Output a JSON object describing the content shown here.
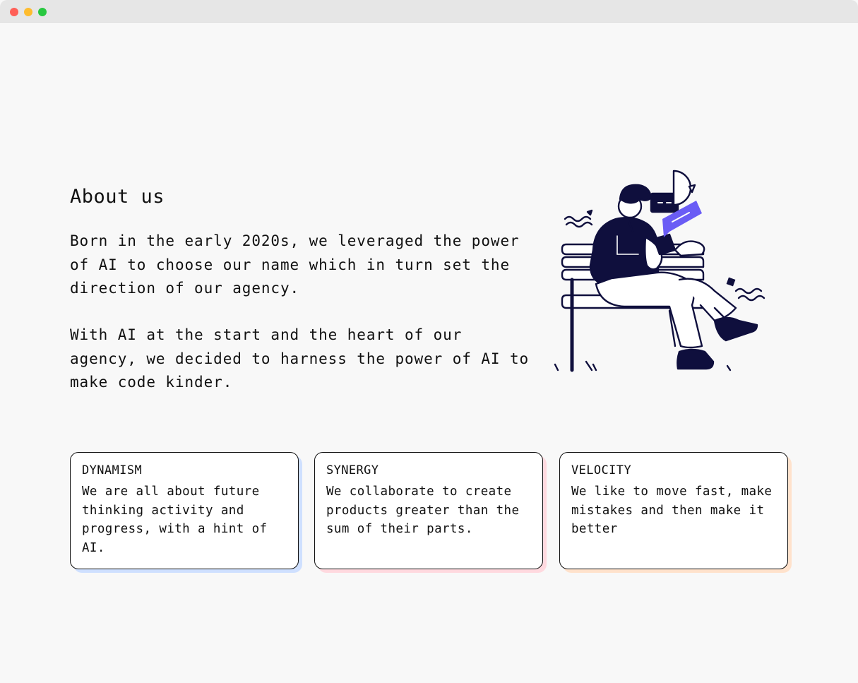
{
  "window": {
    "controls": [
      "close",
      "minimize",
      "maximize"
    ]
  },
  "about": {
    "heading": "About us",
    "paragraph_1": "Born in the early 2020s, we leveraged the power of AI to choose our name which in turn set the direction of our agency.",
    "paragraph_2": "With AI at the start and the heart of our agency, we decided to harness the power of AI to make code kinder."
  },
  "illustration": {
    "icon": "person-on-bench-with-phone-illustration",
    "colors": {
      "ink": "#0f0f3d",
      "accent": "#6a5cf5"
    }
  },
  "values": [
    {
      "title": "DYNAMISM",
      "body": "We are all about future thinking activity and progress, with a hint of AI.",
      "shadow_color": "#cfe0ff"
    },
    {
      "title": "SYNERGY",
      "body": "We collaborate to create products greater than the sum of their parts.",
      "shadow_color": "#ffd9df"
    },
    {
      "title": "VELOCITY",
      "body": "We like to move fast, make mistakes and then make it better",
      "shadow_color": "#ffe2cc"
    }
  ]
}
